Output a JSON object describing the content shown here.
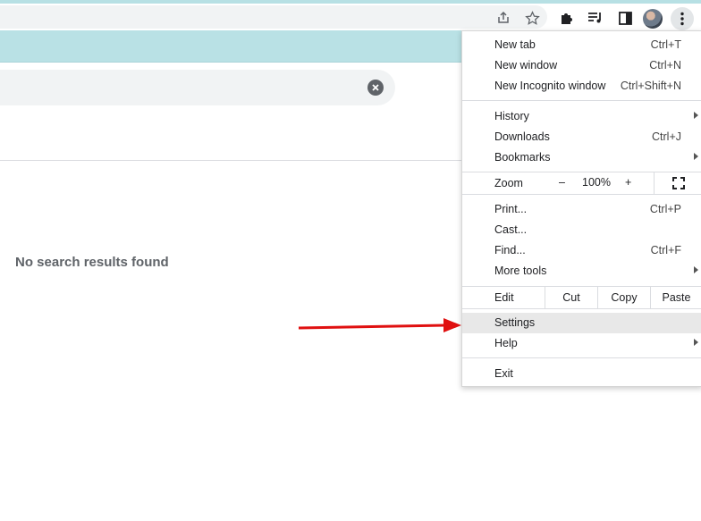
{
  "content": {
    "no_results_text": "No search results found"
  },
  "menu": {
    "items_group1": [
      {
        "label": "New tab",
        "shortcut": "Ctrl+T"
      },
      {
        "label": "New window",
        "shortcut": "Ctrl+N"
      },
      {
        "label": "New Incognito window",
        "shortcut": "Ctrl+Shift+N"
      }
    ],
    "items_group2": [
      {
        "label": "History",
        "shortcut": ""
      },
      {
        "label": "Downloads",
        "shortcut": "Ctrl+J"
      },
      {
        "label": "Bookmarks",
        "shortcut": ""
      }
    ],
    "zoom": {
      "label": "Zoom",
      "minus": "–",
      "value": "100%",
      "plus": "+"
    },
    "items_group3": [
      {
        "label": "Print...",
        "shortcut": "Ctrl+P"
      },
      {
        "label": "Cast...",
        "shortcut": ""
      },
      {
        "label": "Find...",
        "shortcut": "Ctrl+F"
      },
      {
        "label": "More tools",
        "shortcut": ""
      }
    ],
    "edit": {
      "label": "Edit",
      "cut": "Cut",
      "copy": "Copy",
      "paste": "Paste"
    },
    "items_group4": [
      {
        "label": "Settings"
      },
      {
        "label": "Help"
      }
    ],
    "exit_label": "Exit"
  },
  "colors": {
    "header_band": "#b9e1e5",
    "arrow": "#e01010",
    "highlight": "#e8e8e8"
  }
}
